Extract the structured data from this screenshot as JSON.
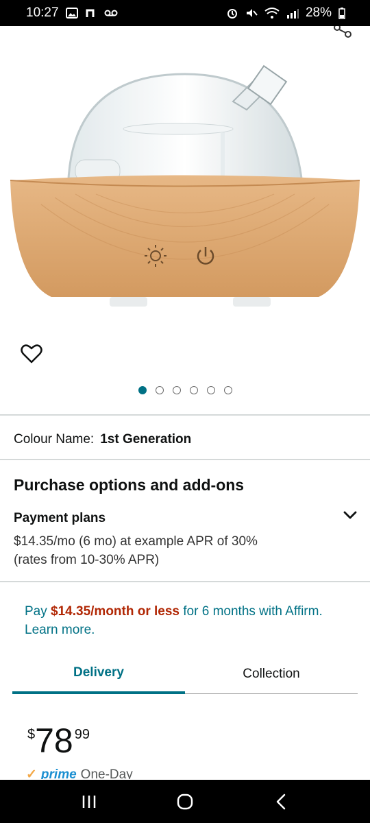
{
  "status_bar": {
    "time": "10:27",
    "battery": "28%",
    "icons_left": [
      "image-icon",
      "n-app-icon",
      "voicemail-icon"
    ],
    "icons_right": [
      "alarm-icon",
      "mute-icon",
      "wifi-icon",
      "signal-icon",
      "battery-icon"
    ]
  },
  "product": {
    "image_alt": "wooden base glass dome aroma diffuser",
    "carousel": {
      "count": 6,
      "active_index": 0
    }
  },
  "colour": {
    "label": "Colour Name:",
    "value": "1st Generation"
  },
  "purchase": {
    "title": "Purchase options and add-ons",
    "payment_title": "Payment plans",
    "payment_line1": "$14.35/mo (6 mo) at example APR of 30%",
    "payment_line2": "(rates from 10-30% APR)"
  },
  "affirm": {
    "prefix": "Pay ",
    "price": "$14.35/month or less",
    "suffix": " for 6 months with Affirm.",
    "learn_more": "Learn more."
  },
  "tabs": [
    {
      "label": "Delivery",
      "active": true
    },
    {
      "label": "Collection",
      "active": false
    }
  ],
  "price": {
    "symbol": "$",
    "whole": "78",
    "fraction": "99"
  },
  "prime": {
    "logo": "prime",
    "text": "One-Day"
  },
  "colors": {
    "accent": "#007185",
    "price_red": "#b12704",
    "divider": "#d5d9d9",
    "wood": "#d9a571"
  }
}
